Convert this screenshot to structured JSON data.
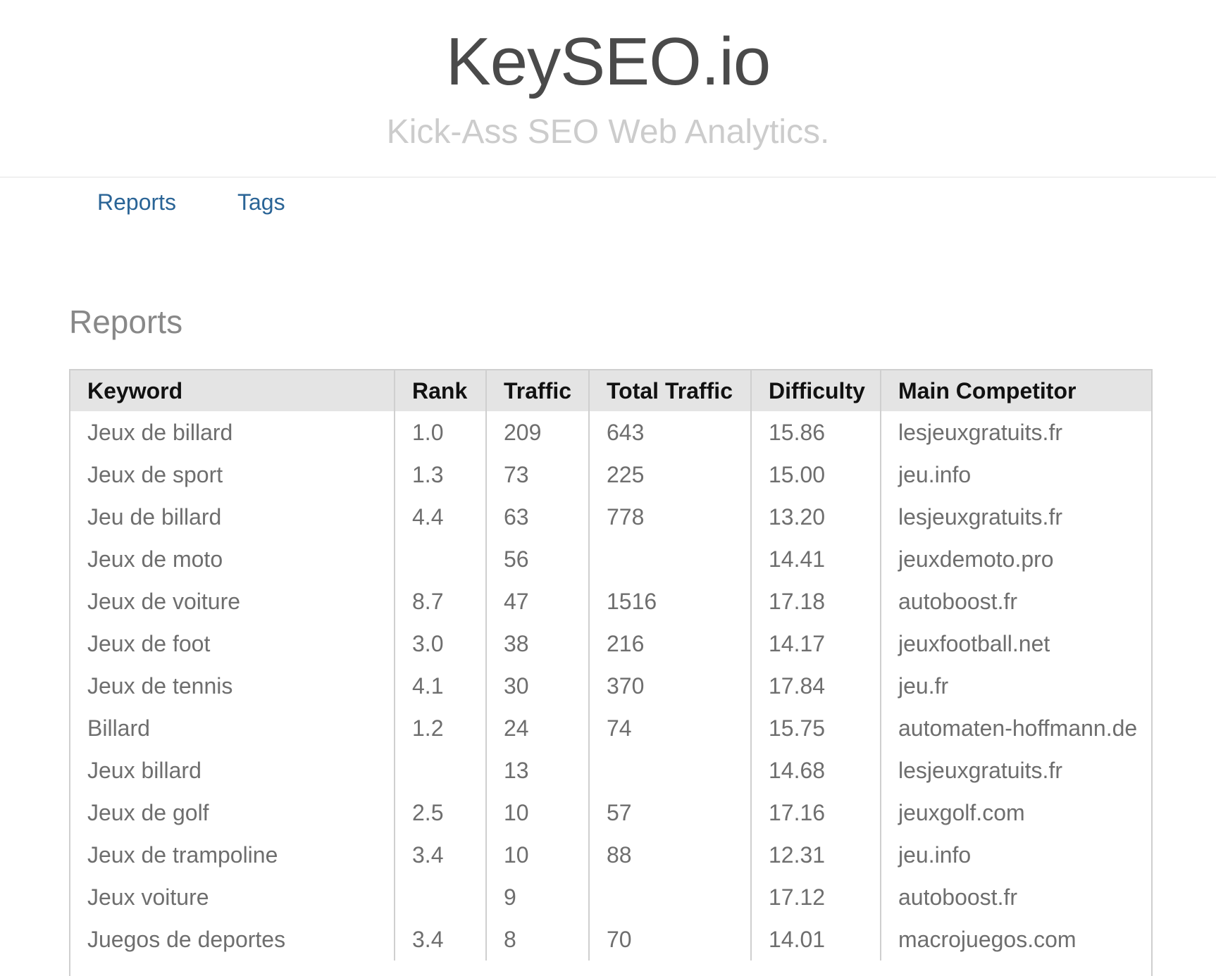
{
  "header": {
    "title": "KeySEO.io",
    "tagline": "Kick-Ass SEO Web Analytics."
  },
  "nav": {
    "items": [
      {
        "label": "Reports"
      },
      {
        "label": "Tags"
      }
    ]
  },
  "main": {
    "heading": "Reports",
    "table": {
      "columns": [
        "Keyword",
        "Rank",
        "Traffic",
        "Total Traffic",
        "Difficulty",
        "Main Competitor"
      ],
      "rows": [
        [
          "Jeux de billard",
          "1.0",
          "209",
          "643",
          "15.86",
          "lesjeuxgratuits.fr"
        ],
        [
          "Jeux de sport",
          "1.3",
          "73",
          "225",
          "15.00",
          "jeu.info"
        ],
        [
          "Jeu de billard",
          "4.4",
          "63",
          "778",
          "13.20",
          "lesjeuxgratuits.fr"
        ],
        [
          "Jeux de moto",
          "",
          "56",
          "",
          "14.41",
          "jeuxdemoto.pro"
        ],
        [
          "Jeux de voiture",
          "8.7",
          "47",
          "1516",
          "17.18",
          "autoboost.fr"
        ],
        [
          "Jeux de foot",
          "3.0",
          "38",
          "216",
          "14.17",
          "jeuxfootball.net"
        ],
        [
          "Jeux de tennis",
          "4.1",
          "30",
          "370",
          "17.84",
          "jeu.fr"
        ],
        [
          "Billard",
          "1.2",
          "24",
          "74",
          "15.75",
          "automaten-hoffmann.de"
        ],
        [
          "Jeux billard",
          "",
          "13",
          "",
          "14.68",
          "lesjeuxgratuits.fr"
        ],
        [
          "Jeux de golf",
          "2.5",
          "10",
          "57",
          "17.16",
          "jeuxgolf.com"
        ],
        [
          "Jeux de trampoline",
          "3.4",
          "10",
          "88",
          "12.31",
          "jeu.info"
        ],
        [
          "Jeux voiture",
          "",
          "9",
          "",
          "17.12",
          "autoboost.fr"
        ],
        [
          "Juegos de deportes",
          "3.4",
          "8",
          "70",
          "14.01",
          "macrojuegos.com"
        ]
      ]
    }
  }
}
